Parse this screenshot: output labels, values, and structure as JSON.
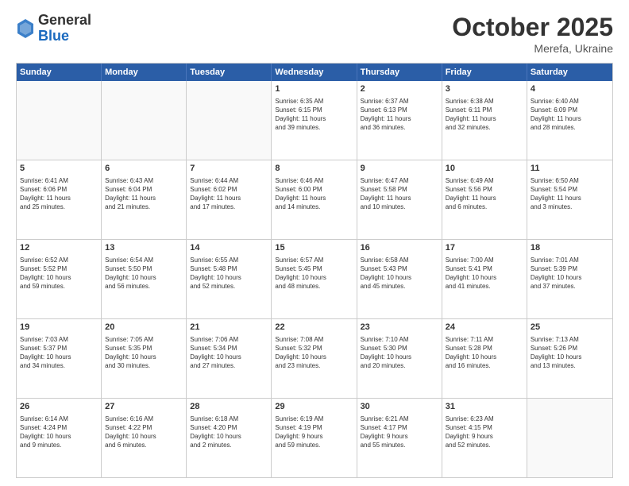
{
  "header": {
    "logo_general": "General",
    "logo_blue": "Blue",
    "month_title": "October 2025",
    "location": "Merefa, Ukraine"
  },
  "weekdays": [
    "Sunday",
    "Monday",
    "Tuesday",
    "Wednesday",
    "Thursday",
    "Friday",
    "Saturday"
  ],
  "rows": [
    [
      {
        "day": "",
        "empty": true
      },
      {
        "day": "",
        "empty": true
      },
      {
        "day": "",
        "empty": true
      },
      {
        "day": "1",
        "lines": [
          "Sunrise: 6:35 AM",
          "Sunset: 6:15 PM",
          "Daylight: 11 hours",
          "and 39 minutes."
        ]
      },
      {
        "day": "2",
        "lines": [
          "Sunrise: 6:37 AM",
          "Sunset: 6:13 PM",
          "Daylight: 11 hours",
          "and 36 minutes."
        ]
      },
      {
        "day": "3",
        "lines": [
          "Sunrise: 6:38 AM",
          "Sunset: 6:11 PM",
          "Daylight: 11 hours",
          "and 32 minutes."
        ]
      },
      {
        "day": "4",
        "lines": [
          "Sunrise: 6:40 AM",
          "Sunset: 6:09 PM",
          "Daylight: 11 hours",
          "and 28 minutes."
        ]
      }
    ],
    [
      {
        "day": "5",
        "lines": [
          "Sunrise: 6:41 AM",
          "Sunset: 6:06 PM",
          "Daylight: 11 hours",
          "and 25 minutes."
        ]
      },
      {
        "day": "6",
        "lines": [
          "Sunrise: 6:43 AM",
          "Sunset: 6:04 PM",
          "Daylight: 11 hours",
          "and 21 minutes."
        ]
      },
      {
        "day": "7",
        "lines": [
          "Sunrise: 6:44 AM",
          "Sunset: 6:02 PM",
          "Daylight: 11 hours",
          "and 17 minutes."
        ]
      },
      {
        "day": "8",
        "lines": [
          "Sunrise: 6:46 AM",
          "Sunset: 6:00 PM",
          "Daylight: 11 hours",
          "and 14 minutes."
        ]
      },
      {
        "day": "9",
        "lines": [
          "Sunrise: 6:47 AM",
          "Sunset: 5:58 PM",
          "Daylight: 11 hours",
          "and 10 minutes."
        ]
      },
      {
        "day": "10",
        "lines": [
          "Sunrise: 6:49 AM",
          "Sunset: 5:56 PM",
          "Daylight: 11 hours",
          "and 6 minutes."
        ]
      },
      {
        "day": "11",
        "lines": [
          "Sunrise: 6:50 AM",
          "Sunset: 5:54 PM",
          "Daylight: 11 hours",
          "and 3 minutes."
        ]
      }
    ],
    [
      {
        "day": "12",
        "lines": [
          "Sunrise: 6:52 AM",
          "Sunset: 5:52 PM",
          "Daylight: 10 hours",
          "and 59 minutes."
        ]
      },
      {
        "day": "13",
        "lines": [
          "Sunrise: 6:54 AM",
          "Sunset: 5:50 PM",
          "Daylight: 10 hours",
          "and 56 minutes."
        ]
      },
      {
        "day": "14",
        "lines": [
          "Sunrise: 6:55 AM",
          "Sunset: 5:48 PM",
          "Daylight: 10 hours",
          "and 52 minutes."
        ]
      },
      {
        "day": "15",
        "lines": [
          "Sunrise: 6:57 AM",
          "Sunset: 5:45 PM",
          "Daylight: 10 hours",
          "and 48 minutes."
        ]
      },
      {
        "day": "16",
        "lines": [
          "Sunrise: 6:58 AM",
          "Sunset: 5:43 PM",
          "Daylight: 10 hours",
          "and 45 minutes."
        ]
      },
      {
        "day": "17",
        "lines": [
          "Sunrise: 7:00 AM",
          "Sunset: 5:41 PM",
          "Daylight: 10 hours",
          "and 41 minutes."
        ]
      },
      {
        "day": "18",
        "lines": [
          "Sunrise: 7:01 AM",
          "Sunset: 5:39 PM",
          "Daylight: 10 hours",
          "and 37 minutes."
        ]
      }
    ],
    [
      {
        "day": "19",
        "lines": [
          "Sunrise: 7:03 AM",
          "Sunset: 5:37 PM",
          "Daylight: 10 hours",
          "and 34 minutes."
        ]
      },
      {
        "day": "20",
        "lines": [
          "Sunrise: 7:05 AM",
          "Sunset: 5:35 PM",
          "Daylight: 10 hours",
          "and 30 minutes."
        ]
      },
      {
        "day": "21",
        "lines": [
          "Sunrise: 7:06 AM",
          "Sunset: 5:34 PM",
          "Daylight: 10 hours",
          "and 27 minutes."
        ]
      },
      {
        "day": "22",
        "lines": [
          "Sunrise: 7:08 AM",
          "Sunset: 5:32 PM",
          "Daylight: 10 hours",
          "and 23 minutes."
        ]
      },
      {
        "day": "23",
        "lines": [
          "Sunrise: 7:10 AM",
          "Sunset: 5:30 PM",
          "Daylight: 10 hours",
          "and 20 minutes."
        ]
      },
      {
        "day": "24",
        "lines": [
          "Sunrise: 7:11 AM",
          "Sunset: 5:28 PM",
          "Daylight: 10 hours",
          "and 16 minutes."
        ]
      },
      {
        "day": "25",
        "lines": [
          "Sunrise: 7:13 AM",
          "Sunset: 5:26 PM",
          "Daylight: 10 hours",
          "and 13 minutes."
        ]
      }
    ],
    [
      {
        "day": "26",
        "lines": [
          "Sunrise: 6:14 AM",
          "Sunset: 4:24 PM",
          "Daylight: 10 hours",
          "and 9 minutes."
        ]
      },
      {
        "day": "27",
        "lines": [
          "Sunrise: 6:16 AM",
          "Sunset: 4:22 PM",
          "Daylight: 10 hours",
          "and 6 minutes."
        ]
      },
      {
        "day": "28",
        "lines": [
          "Sunrise: 6:18 AM",
          "Sunset: 4:20 PM",
          "Daylight: 10 hours",
          "and 2 minutes."
        ]
      },
      {
        "day": "29",
        "lines": [
          "Sunrise: 6:19 AM",
          "Sunset: 4:19 PM",
          "Daylight: 9 hours",
          "and 59 minutes."
        ]
      },
      {
        "day": "30",
        "lines": [
          "Sunrise: 6:21 AM",
          "Sunset: 4:17 PM",
          "Daylight: 9 hours",
          "and 55 minutes."
        ]
      },
      {
        "day": "31",
        "lines": [
          "Sunrise: 6:23 AM",
          "Sunset: 4:15 PM",
          "Daylight: 9 hours",
          "and 52 minutes."
        ]
      },
      {
        "day": "",
        "empty": true
      }
    ]
  ]
}
